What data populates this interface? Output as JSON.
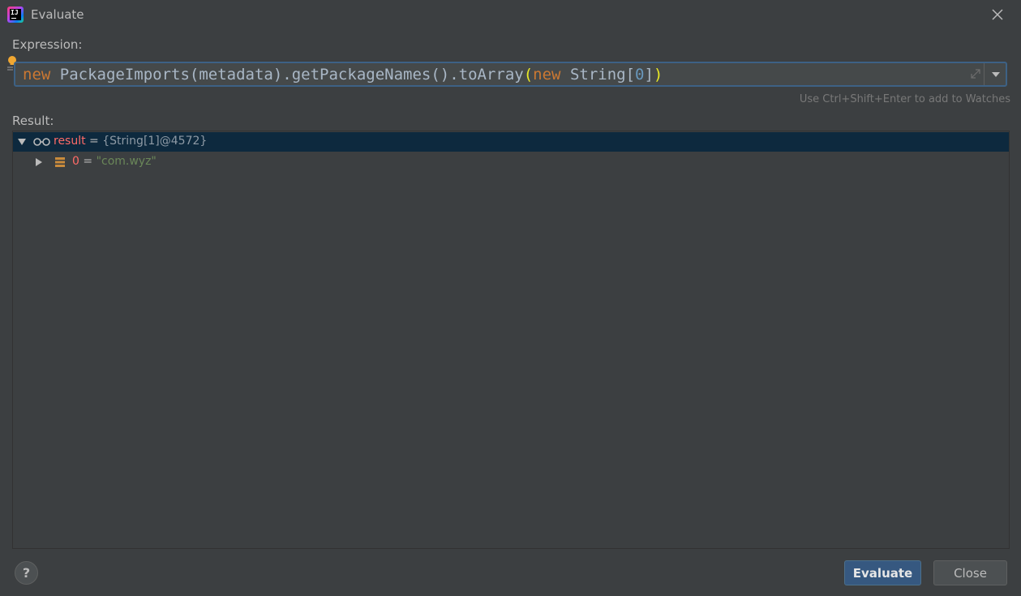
{
  "window": {
    "title": "Evaluate"
  },
  "expression": {
    "label": "Expression:",
    "tokens": {
      "kw1": "new",
      "part1": " PackageImports(metadata).getPackageNames().toArray",
      "open_paren": "(",
      "kw2": "new",
      "part2": " String[",
      "num": "0",
      "part3": "]",
      "close_paren": ")"
    },
    "hint": "Use Ctrl+Shift+Enter to add to Watches"
  },
  "result": {
    "label": "Result:",
    "rows": [
      {
        "name": "result",
        "eq": " = ",
        "value": "{String[1]@4572}",
        "expanded": true,
        "icon": "watch-glasses-icon"
      },
      {
        "name": "0",
        "eq": " = ",
        "value": "\"com.wyz\"",
        "expanded": false,
        "icon": "array-field-icon"
      }
    ]
  },
  "buttons": {
    "help": "?",
    "evaluate": "Evaluate",
    "close": "Close"
  },
  "colors": {
    "background": "#3c3f41",
    "accent": "#365880",
    "selection": "#0d293e",
    "keyword": "#cc7832",
    "string": "#6a8759",
    "variable": "#ff6b68"
  }
}
